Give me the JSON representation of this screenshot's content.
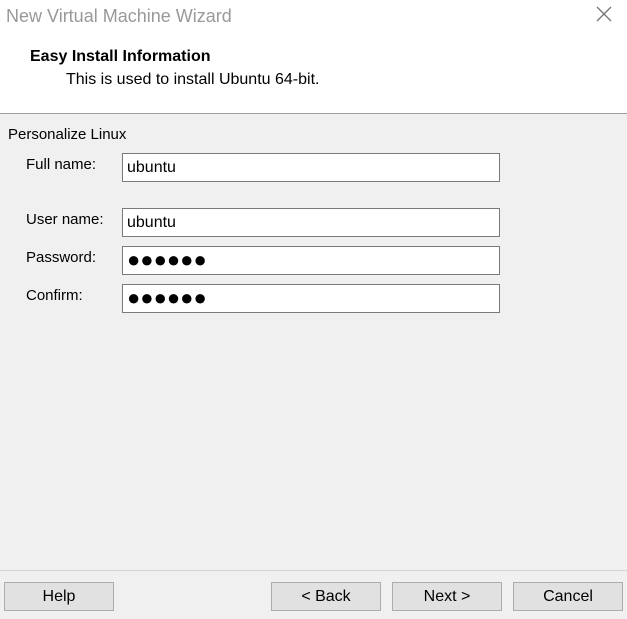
{
  "window": {
    "title": "New Virtual Machine Wizard",
    "close_icon": "close-icon"
  },
  "header": {
    "title": "Easy Install Information",
    "subtitle": "This is used to install Ubuntu 64-bit."
  },
  "form": {
    "group_label": "Personalize Linux",
    "full_name": {
      "label": "Full name:",
      "value": "ubuntu"
    },
    "user_name": {
      "label": "User name:",
      "value": "ubuntu"
    },
    "password": {
      "label": "Password:",
      "value": "●●●●●●"
    },
    "confirm": {
      "label": "Confirm:",
      "value": "●●●●●●"
    }
  },
  "buttons": {
    "help": "Help",
    "back": "< Back",
    "next": "Next >",
    "cancel": "Cancel"
  }
}
